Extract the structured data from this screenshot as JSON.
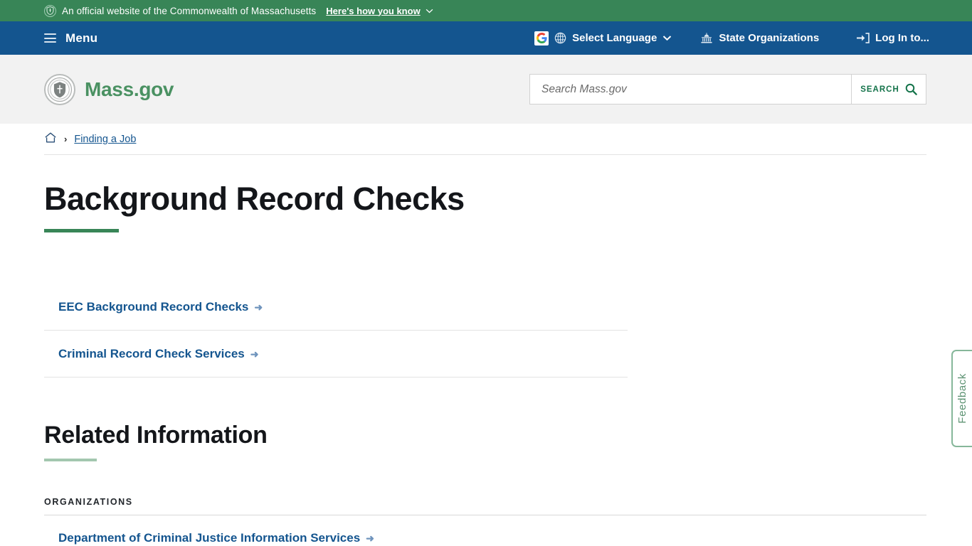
{
  "banner": {
    "shield_icon": "shield-icon",
    "text": "An official website of the Commonwealth of Massachusetts",
    "how_you_know": "Here's how you know",
    "chevron_icon": "chevron-down-icon",
    "bg_color": "#388557"
  },
  "nav": {
    "menu_icon": "hamburger-icon",
    "menu_label": "Menu",
    "google_icon": "google-translate-icon",
    "google_letter": "G",
    "globe_icon": "globe-icon",
    "select_language": "Select Language",
    "language_chevron_icon": "chevron-down-icon",
    "capitol_icon": "capitol-building-icon",
    "state_organizations": "State Organizations",
    "login_icon": "sign-in-icon",
    "login_label": "Log In to...",
    "bg_color": "#14558f"
  },
  "header": {
    "seal_icon": "massachusetts-seal-icon",
    "logo_text": "Mass.gov",
    "logo_color": "#4a9162",
    "search": {
      "placeholder": "Search Mass.gov",
      "value": "",
      "button_label": "SEARCH",
      "search_icon": "search-icon"
    }
  },
  "breadcrumb": {
    "home_icon": "home-icon",
    "separator": "›",
    "items": [
      {
        "label": "Finding a Job"
      }
    ]
  },
  "main": {
    "page_title": "Background Record Checks",
    "links": [
      {
        "label": "EEC Background Record Checks",
        "arrow": "➜"
      },
      {
        "label": "Criminal Record Check Services",
        "arrow": "➜"
      }
    ],
    "related": {
      "heading": "Related Information",
      "organizations_label": "ORGANIZATIONS",
      "organizations": [
        {
          "label": "Department of Criminal Justice Information Services",
          "arrow": "➜"
        }
      ]
    },
    "link_color": "#14558f"
  },
  "feedback": {
    "label": "Feedback",
    "color": "#5d9373"
  }
}
